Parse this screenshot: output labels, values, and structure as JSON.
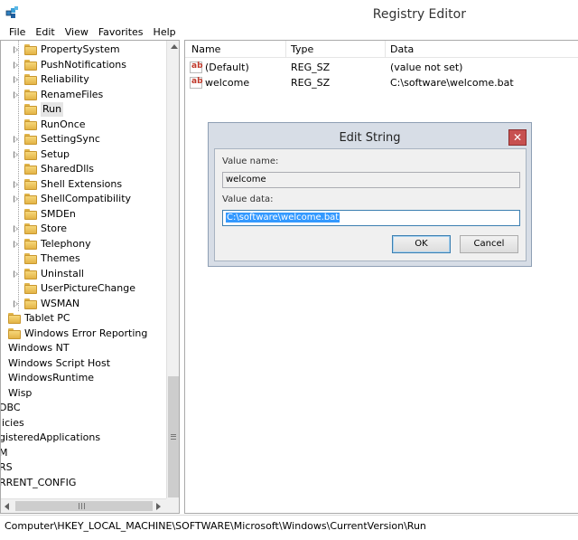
{
  "window": {
    "title": "Registry Editor"
  },
  "menu": [
    "File",
    "Edit",
    "View",
    "Favorites",
    "Help"
  ],
  "tree": {
    "items": [
      {
        "label": "PropertySystem",
        "expander": true
      },
      {
        "label": "PushNotifications",
        "expander": true
      },
      {
        "label": "Reliability",
        "expander": true
      },
      {
        "label": "RenameFiles",
        "expander": true
      },
      {
        "label": "Run",
        "expander": false,
        "selected": true
      },
      {
        "label": "RunOnce",
        "expander": false
      },
      {
        "label": "SettingSync",
        "expander": true
      },
      {
        "label": "Setup",
        "expander": true
      },
      {
        "label": "SharedDlls",
        "expander": false
      },
      {
        "label": "Shell Extensions",
        "expander": true
      },
      {
        "label": "ShellCompatibility",
        "expander": true
      },
      {
        "label": "SMDEn",
        "expander": false
      },
      {
        "label": "Store",
        "expander": true
      },
      {
        "label": "Telephony",
        "expander": true
      },
      {
        "label": "Themes",
        "expander": false
      },
      {
        "label": "Uninstall",
        "expander": true
      },
      {
        "label": "UserPictureChange",
        "expander": false
      },
      {
        "label": "WSMAN",
        "expander": true
      }
    ],
    "parent_items": [
      {
        "label": "Tablet PC",
        "folder": true
      },
      {
        "label": "Windows Error Reporting",
        "folder": true
      },
      {
        "label": "Windows NT",
        "folder": false
      },
      {
        "label": "Windows Script Host",
        "folder": false
      },
      {
        "label": "WindowsRuntime",
        "folder": false
      },
      {
        "label": "Wisp",
        "folder": false
      }
    ],
    "root_items": [
      "DBC",
      "licies",
      "gisteredApplications",
      "M",
      "RS",
      "RRENT_CONFIG"
    ]
  },
  "list": {
    "columns": [
      "Name",
      "Type",
      "Data"
    ],
    "rows": [
      {
        "name": "(Default)",
        "type": "REG_SZ",
        "data": "(value not set)"
      },
      {
        "name": "welcome",
        "type": "REG_SZ",
        "data": "C:\\software\\welcome.bat"
      }
    ]
  },
  "dialog": {
    "title": "Edit String",
    "value_name_label": "Value name:",
    "value_name": "welcome",
    "value_data_label": "Value data:",
    "value_data": "C:\\software\\welcome.bat",
    "ok_label": "OK",
    "cancel_label": "Cancel",
    "close_glyph": "✕"
  },
  "statusbar": {
    "path": "Computer\\HKEY_LOCAL_MACHINE\\SOFTWARE\\Microsoft\\Windows\\CurrentVersion\\Run"
  },
  "colors": {
    "selection": "#3399ff",
    "close_button": "#c75050",
    "folder": "#e8bd52",
    "dialog_frame": "#d7dde6"
  }
}
